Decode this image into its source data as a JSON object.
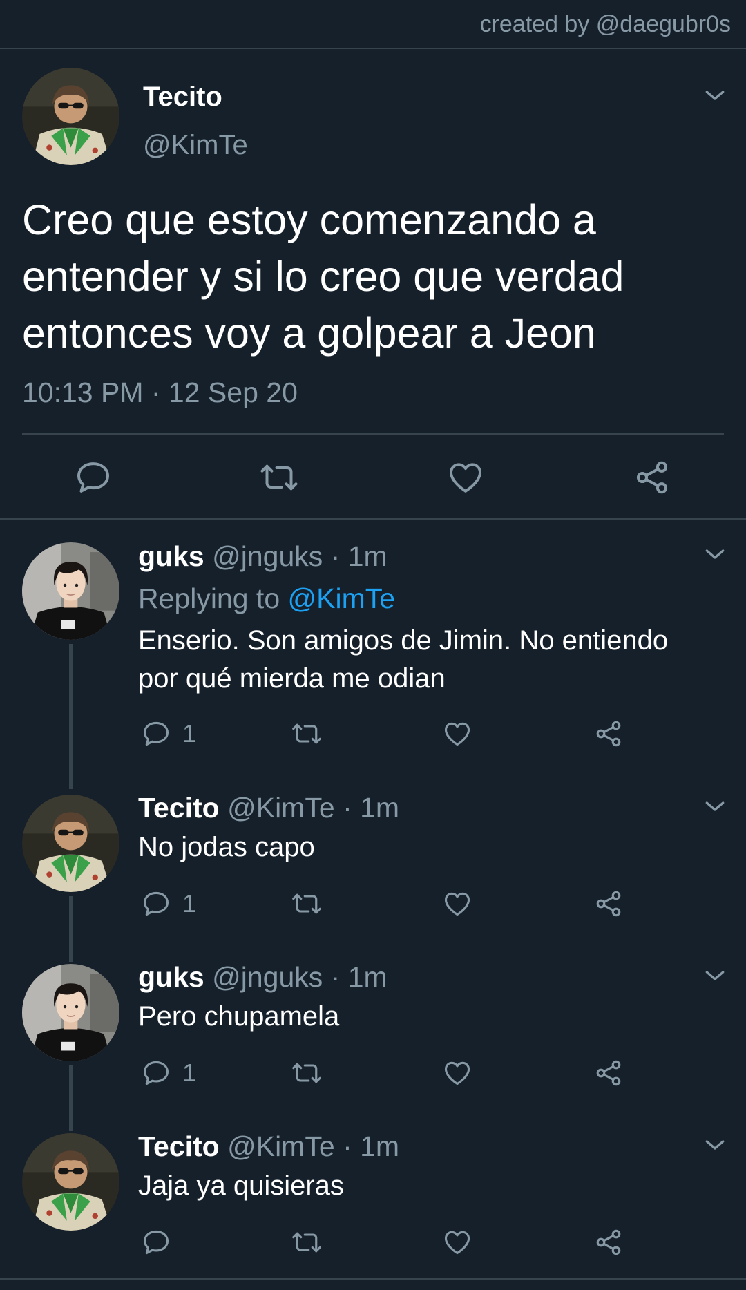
{
  "credit": "created by @daegubr0s",
  "main_tweet": {
    "name": "Tecito",
    "handle": "@KimTe",
    "text": "Creo que estoy comenzando a\nentender y si lo creo que verdad\nentonces voy a golpear a Jeon",
    "timestamp": "10:13 PM · 12 Sep 20"
  },
  "replies": [
    {
      "name": "guks",
      "handle": "@jnguks",
      "dot": "·",
      "time": "1m",
      "replying_label": "Replying to",
      "replying_mention": "@KimTe",
      "text": "Enserio. Son amigos de Jimin. No entiendo\npor qué mierda me odian",
      "reply_count": "1"
    },
    {
      "name": "Tecito",
      "handle": "@KimTe",
      "dot": "·",
      "time": "1m",
      "text": "No jodas capo",
      "reply_count": "1"
    },
    {
      "name": "guks",
      "handle": "@jnguks",
      "dot": "·",
      "time": "1m",
      "text": "Pero chupamela",
      "reply_count": "1"
    },
    {
      "name": "Tecito",
      "handle": "@KimTe",
      "dot": "·",
      "time": "1m",
      "text": "Jaja ya quisieras",
      "reply_count": ""
    }
  ],
  "icons": {
    "reply": "reply-icon",
    "retweet": "retweet-icon",
    "like": "heart-icon",
    "share": "share-icon",
    "more": "chevron-down-icon"
  },
  "colors": {
    "background": "#15202b",
    "secondary_text": "#8899a6",
    "divider": "#38444d",
    "mention": "#1da1f2"
  }
}
